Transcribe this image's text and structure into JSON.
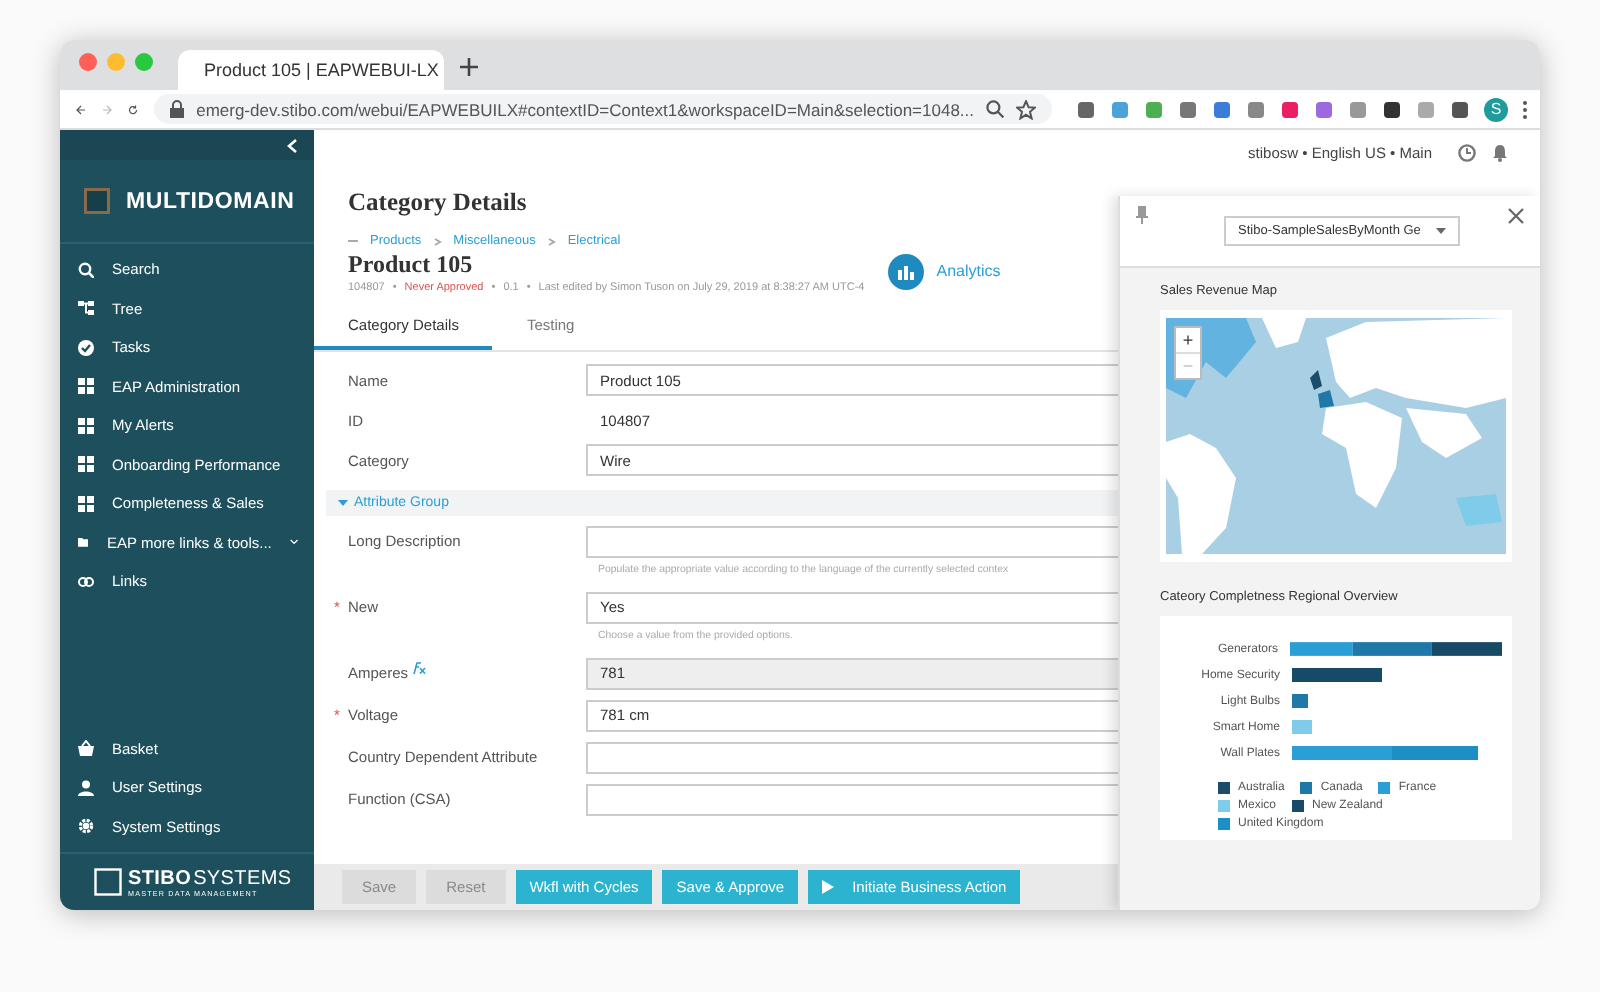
{
  "browser": {
    "tab_title": "Product 105 | EAPWEBUI-LX",
    "url": "emerg-dev.stibo.com/webui/EAPWEBUILX#contextID=Context1&workspaceID=Main&selection=1048...",
    "account_initial": "S"
  },
  "user_info": "stibosw • English US • Main",
  "sidebar": {
    "logo": "MULTIDOMAIN",
    "items": [
      {
        "label": "Search",
        "kind": "search",
        "expandable": false
      },
      {
        "label": "Tree",
        "kind": "tree",
        "expandable": false
      },
      {
        "label": "Tasks",
        "kind": "tasks",
        "expandable": false
      },
      {
        "label": "EAP Administration",
        "kind": "dashboard",
        "expandable": false
      },
      {
        "label": "My Alerts",
        "kind": "dashboard",
        "expandable": false
      },
      {
        "label": "Onboarding Performance",
        "kind": "dashboard",
        "expandable": false
      },
      {
        "label": "Completeness & Sales",
        "kind": "dashboard",
        "expandable": false
      },
      {
        "label": "EAP more links & tools...",
        "kind": "folder",
        "expandable": true
      },
      {
        "label": "Links",
        "kind": "links",
        "expandable": false
      }
    ],
    "bottom_items": [
      {
        "label": "Basket",
        "kind": "basket"
      },
      {
        "label": "User Settings",
        "kind": "user"
      },
      {
        "label": "System Settings",
        "kind": "settings"
      }
    ],
    "footer": {
      "brand": "STIBO",
      "brand_rest": "SYSTEMS",
      "tagline": "MASTER DATA MANAGEMENT"
    }
  },
  "page": {
    "title": "Category Details",
    "breadcrumb": [
      "Products",
      "Miscellaneous",
      "Electrical"
    ],
    "object_title": "Product 105",
    "meta": {
      "id": "104807",
      "status": "Never Approved",
      "version": "0.1",
      "edited": "Last edited by Simon Tuson on July 29, 2019 at 8:38:27 AM UTC-4",
      "separators": [
        "•",
        "•",
        "•"
      ]
    },
    "analytics": "Analytics",
    "tabs": [
      {
        "label": "Category Details",
        "selected": true
      },
      {
        "label": "Testing",
        "selected": false
      }
    ],
    "fields": [
      {
        "label": "Name",
        "value": "Product 105",
        "kind": "input"
      },
      {
        "label": "ID",
        "value": "104807",
        "kind": "text"
      },
      {
        "label": "Category",
        "value": "Wire",
        "kind": "input"
      }
    ],
    "group": {
      "label": "Attribute Group",
      "expanded": true
    },
    "attributes": [
      {
        "label": "Long Description",
        "readonly": false,
        "calculated": false,
        "help": "Populate the appropriate value according to the language of the currently selected contex"
      },
      {
        "label": "New",
        "value": "Yes",
        "required_mark": "*",
        "readonly": false,
        "calculated": false,
        "help": "Choose a value from the provided options."
      },
      {
        "label": "Amperes",
        "value": "781",
        "readonly": true,
        "calculated": true
      },
      {
        "label": "Voltage",
        "value": "781 cm",
        "required_mark": "*",
        "readonly": false,
        "calculated": false
      },
      {
        "label": "Country Dependent Attribute",
        "readonly": false,
        "calculated": false
      },
      {
        "label": "Function (CSA)",
        "readonly": false,
        "calculated": false
      }
    ],
    "buttons": [
      {
        "label": "Save",
        "disabled": true,
        "kind": "plain"
      },
      {
        "label": "Reset",
        "disabled": true,
        "kind": "plain"
      },
      {
        "label": "Wkfl with Cycles",
        "disabled": false,
        "kind": "plain"
      },
      {
        "label": "Save & Approve",
        "disabled": false,
        "kind": "plain"
      },
      {
        "label": "Initiate Business Action",
        "disabled": false,
        "kind": "action"
      }
    ]
  },
  "panel": {
    "selector": "Stibo-SampleSalesByMonth Ge",
    "map": {
      "title": "Sales Revenue Map",
      "zoom_in": "+",
      "zoom_out": "−"
    },
    "completeness_chart": {
      "title": "Cateory Completness Regional Overview",
      "categories": [
        "Generators",
        "Home Security",
        "Light Bulbs",
        "Smart Home",
        "Wall Plates"
      ],
      "legend": [
        {
          "name": "Australia",
          "color": "#1b4d6b"
        },
        {
          "name": "Canada",
          "color": "#1f78a8"
        },
        {
          "name": "France",
          "color": "#2a9fd6"
        },
        {
          "name": "Mexico",
          "color": "#7fcbea"
        },
        {
          "name": "New Zealand",
          "color": "#174a66"
        },
        {
          "name": "United Kingdom",
          "color": "#1e8fc4"
        }
      ]
    }
  }
}
